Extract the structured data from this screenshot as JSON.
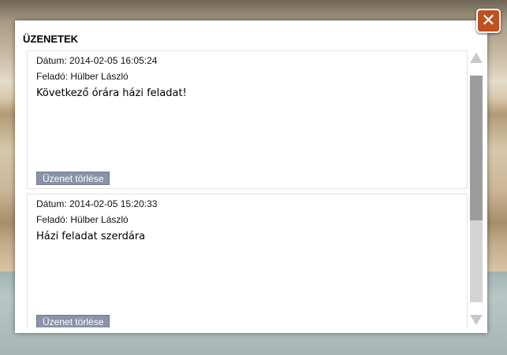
{
  "dialog": {
    "title": "ÜZENETEK",
    "close_icon": "close-x-icon",
    "close_symbol": "✕"
  },
  "messages": [
    {
      "date_line": "Dátum: 2014-02-05 16:05:24",
      "sender_line": "Feladó: Hülber László",
      "body": "Következő órára házi feladat!",
      "delete_label": "Üzenet törlése"
    },
    {
      "date_line": "Dátum: 2014-02-05 15:20:33",
      "sender_line": "Feladó: Hülber László",
      "body": "Házi feladat szerdára",
      "delete_label": "Üzenet törlése"
    }
  ],
  "colors": {
    "close_button": "#c0511f",
    "delete_button": "#8b93a9",
    "scroll_thumb": "#9c9c9c"
  }
}
